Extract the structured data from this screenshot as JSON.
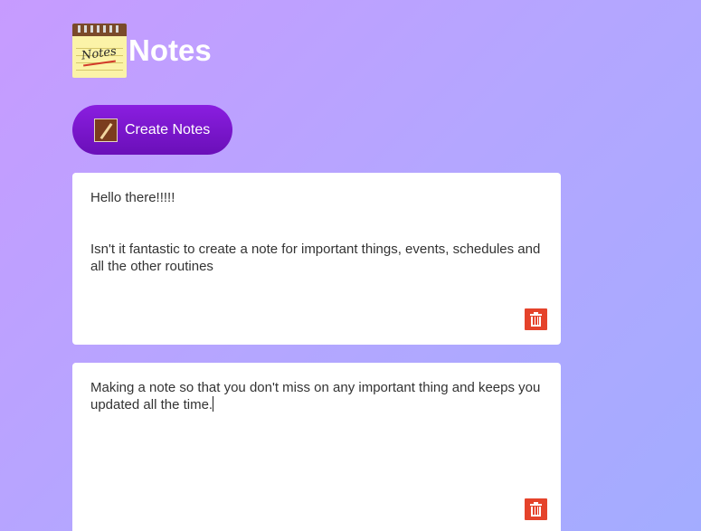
{
  "app": {
    "title": "Notes",
    "logo_text": "Notes"
  },
  "toolbar": {
    "create_label": "Create Notes"
  },
  "notes": [
    {
      "text": "Hello there!!!!!\n\n\nIsn't it fantastic to create a note for important things, events, schedules and all the other routines"
    },
    {
      "text": "Making a note so that you don't miss on any important thing and keeps you updated all the time."
    }
  ],
  "icons": {
    "logo": "notepad-icon",
    "create": "pen-icon",
    "delete": "trash-icon"
  },
  "colors": {
    "accent": "#7b16cf",
    "delete": "#e5432b"
  }
}
